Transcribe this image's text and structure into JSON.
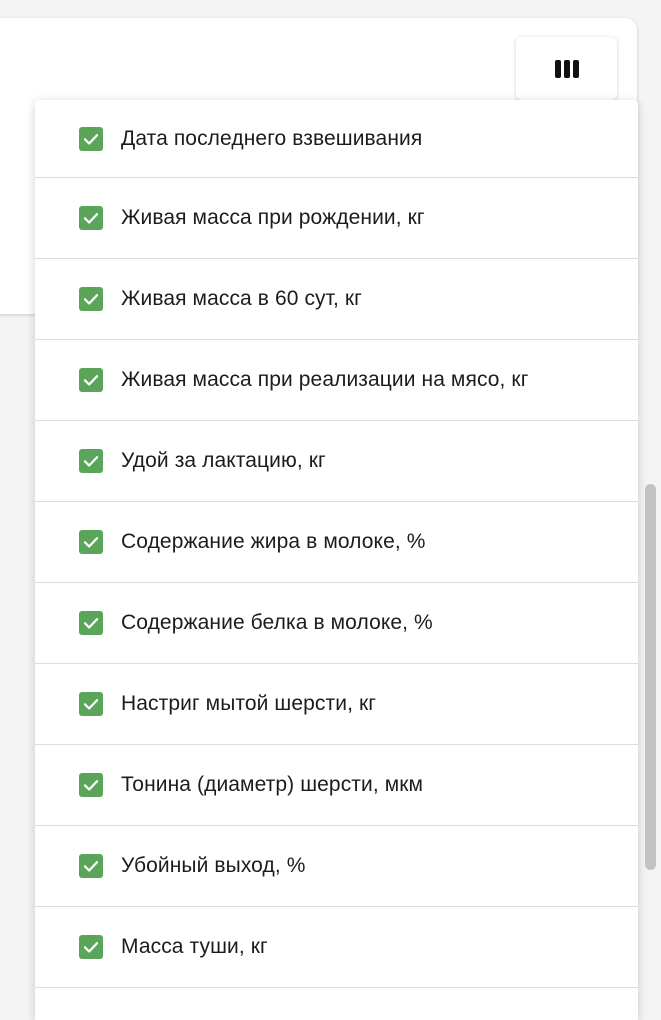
{
  "theme": {
    "checkbox_color": "#5ba55b",
    "checkmark_color": "#ffffff"
  },
  "toolbar": {
    "columns_button_icon": "view-columns-icon"
  },
  "column_menu": {
    "items": [
      {
        "label": "Дата последнего взвешивания",
        "checked": true
      },
      {
        "label": "Живая масса при рождении, кг",
        "checked": true
      },
      {
        "label": "Живая масса в 60 сут, кг",
        "checked": true
      },
      {
        "label": "Живая масса при реализации на мясо, кг",
        "checked": true
      },
      {
        "label": "Удой за лактацию, кг",
        "checked": true
      },
      {
        "label": "Содержание жира в молоке, %",
        "checked": true
      },
      {
        "label": "Содержание белка в молоке, %",
        "checked": true
      },
      {
        "label": "Настриг мытой шерсти, кг",
        "checked": true
      },
      {
        "label": "Тонина (диаметр) шерсти, мкм",
        "checked": true
      },
      {
        "label": "Убойный выход, %",
        "checked": true
      },
      {
        "label": "Масса туши, кг",
        "checked": true
      }
    ]
  }
}
